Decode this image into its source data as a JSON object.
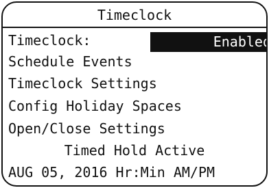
{
  "header": {
    "title": "Timeclock"
  },
  "menu": {
    "status_label": "Timeclock:",
    "status_value": "Enabled",
    "items": [
      "Schedule Events",
      "Timeclock Settings",
      "Config Holiday Spaces",
      "Open/Close Settings"
    ]
  },
  "status": {
    "message": "Timed Hold Active"
  },
  "footer": {
    "datetime": "AUG 05, 2016 Hr:Min AM/PM"
  },
  "colors": {
    "foreground": "#111111",
    "background": "#ffffff",
    "highlight": "#111111"
  }
}
